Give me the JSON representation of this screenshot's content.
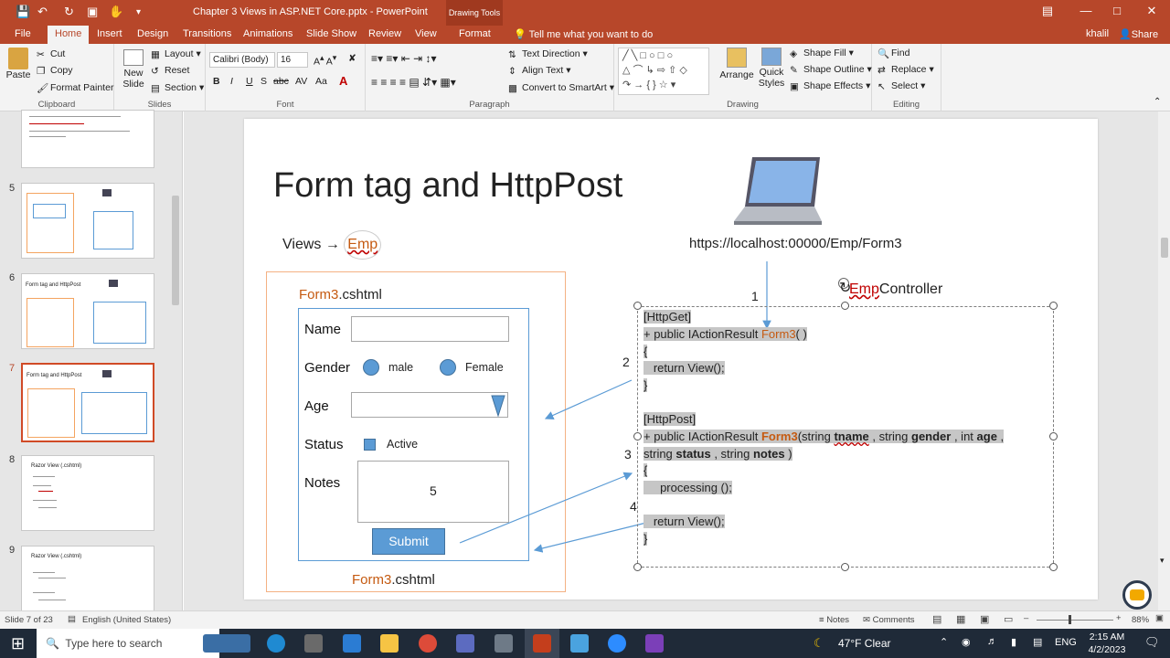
{
  "titlebar": {
    "title": "Chapter 3  Views in ASP.NET Core.pptx  -  PowerPoint",
    "context_tab": "Drawing Tools",
    "tell_me": "Tell me what you want to do"
  },
  "tabs": [
    "File",
    "Home",
    "Insert",
    "Design",
    "Transitions",
    "Animations",
    "Slide Show",
    "Review",
    "View",
    "Format"
  ],
  "active_tab": "Home",
  "user": {
    "name": "khalil",
    "share": "Share"
  },
  "ribbon": {
    "clipboard": {
      "paste": "Paste",
      "cut": "Cut",
      "copy": "Copy",
      "format_painter": "Format Painter",
      "label": "Clipboard"
    },
    "slides": {
      "new_slide": "New Slide",
      "layout": "Layout",
      "reset": "Reset",
      "section": "Section",
      "label": "Slides"
    },
    "font": {
      "face": "Calibri (Body)",
      "size": "16",
      "label": "Font"
    },
    "paragraph": {
      "text_direction": "Text Direction",
      "align_text": "Align Text",
      "convert": "Convert to SmartArt",
      "label": "Paragraph"
    },
    "drawing": {
      "arrange": "Arrange",
      "quick_styles": "Quick Styles",
      "shape_fill": "Shape Fill",
      "shape_outline": "Shape Outline",
      "shape_effects": "Shape Effects",
      "label": "Drawing"
    },
    "editing": {
      "find": "Find",
      "replace": "Replace",
      "select": "Select",
      "label": "Editing"
    }
  },
  "thumbnails": [
    {
      "num": "5"
    },
    {
      "num": "6",
      "title": "Form tag and HttpPost"
    },
    {
      "num": "7",
      "title": "Form tag and HttpPost"
    },
    {
      "num": "8",
      "title": "Razor View (.cshtml)"
    },
    {
      "num": "9",
      "title": "Razor View (.cshtml)"
    }
  ],
  "slide": {
    "title": "Form tag and HttpPost",
    "views_label": "Views →",
    "views_folder": "Emp",
    "url": "https://localhost:00000/Emp/Form3",
    "controller_prefix": "Emp",
    "controller_suffix": "Controller",
    "form_file_top": {
      "name": "Form3",
      "ext": ".cshtml"
    },
    "form_file_bottom": {
      "name": "Form3",
      "ext": ".cshtml"
    },
    "form": {
      "name_label": "Name",
      "gender_label": "Gender",
      "male": "male",
      "female": "Female",
      "age_label": "Age",
      "status_label": "Status",
      "active": "Active",
      "notes_label": "Notes",
      "notes_value": "5",
      "submit": "Submit"
    },
    "steps": [
      "1",
      "2",
      "3",
      "4"
    ],
    "code": {
      "get_attr": "[HttpGet]",
      "get_sig_pre": "+ public IActionResult ",
      "get_method": "Form3",
      "get_sig_post": "( )",
      "brace_open": "{",
      "return_view": "return View();",
      "brace_close": "}",
      "post_attr": "[HttpPost]",
      "post_sig_pre": "+ public IActionResult ",
      "post_method": "Form3",
      "post_p1": "(string ",
      "post_tname": "tname",
      "post_p2": "  , string ",
      "post_gender": "gender",
      "post_p3": " , int ",
      "post_age": "age",
      "post_p4": " ,",
      "post_l2a": "string ",
      "post_status": "status",
      "post_l2b": " , string ",
      "post_notes": "notes",
      "post_l2c": " )",
      "processing": "processing ();"
    }
  },
  "status": {
    "slide_of": "Slide 7 of 23",
    "language": "English (United States)",
    "notes": "Notes",
    "comments": "Comments",
    "zoom": "88%"
  },
  "taskbar": {
    "search": "Type here to search",
    "weather": "47°F  Clear",
    "lang": "ENG",
    "time": "2:15 AM",
    "date": "4/2/2023"
  },
  "colors": {
    "accent": "#b7472a",
    "shape_blue": "#5b9bd5",
    "code_highlight": "#c6c6c6",
    "method_orange": "#c55a11"
  }
}
